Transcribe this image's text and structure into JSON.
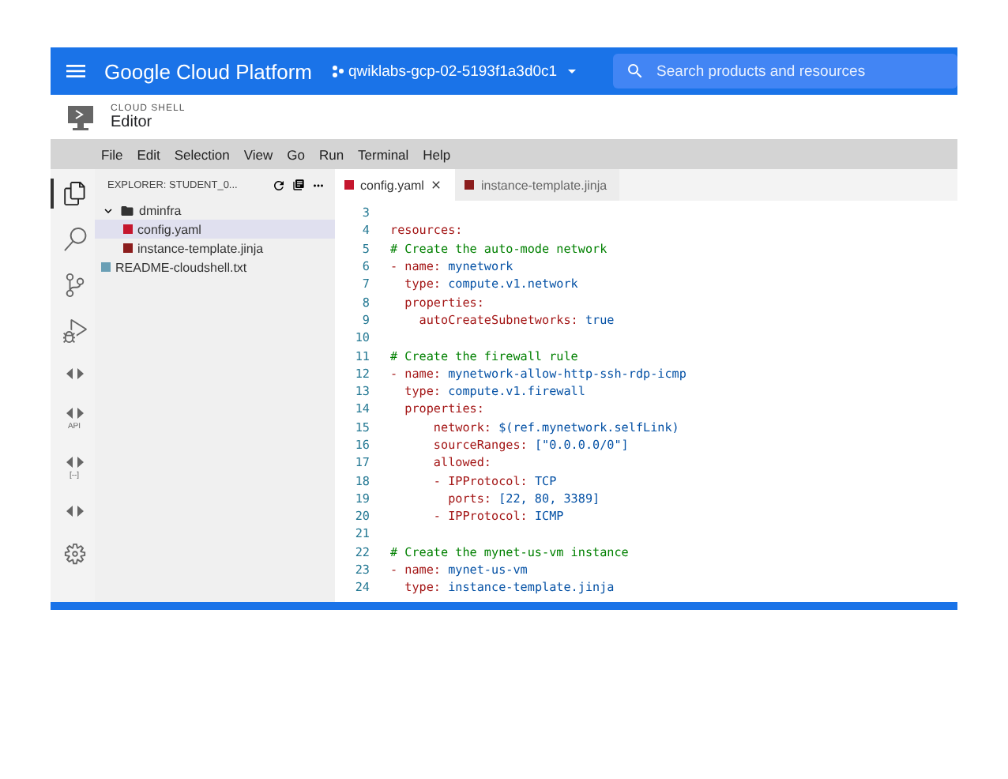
{
  "header": {
    "title": "Google Cloud Platform",
    "project": "qwiklabs-gcp-02-5193f1a3d0c1",
    "search": {
      "placeholder": "Search products and resources"
    }
  },
  "shell_header": {
    "overline": "CLOUD SHELL",
    "title": "Editor"
  },
  "menu": [
    "File",
    "Edit",
    "Selection",
    "View",
    "Go",
    "Run",
    "Terminal",
    "Help"
  ],
  "activity_bar": [
    {
      "kind": "files",
      "selected": true
    },
    {
      "kind": "search",
      "selected": false
    },
    {
      "kind": "source",
      "selected": false
    },
    {
      "kind": "debug",
      "selected": false
    },
    {
      "kind": "code-run",
      "selected": false
    },
    {
      "kind": "code-api",
      "label": "API",
      "selected": false
    },
    {
      "kind": "code-k8s",
      "label": "[--]",
      "selected": false
    },
    {
      "kind": "code-gear",
      "selected": false
    },
    {
      "kind": "settings",
      "selected": false
    }
  ],
  "explorer": {
    "title": "EXPLORER: STUDENT_0...",
    "tree": [
      {
        "name": "dminfra",
        "kind": "folder",
        "expanded": true,
        "selected": false,
        "children": [
          {
            "name": "config.yaml",
            "kind": "yaml",
            "selected": true
          },
          {
            "name": "instance-template.jinja",
            "kind": "jinja",
            "selected": false
          }
        ]
      },
      {
        "name": "README-cloudshell.txt",
        "kind": "text",
        "selected": false
      }
    ]
  },
  "tabs": [
    {
      "label": "config.yaml",
      "kind": "yaml",
      "selected": true
    },
    {
      "label": "instance-template.jinja",
      "kind": "jinja",
      "selected": false
    }
  ],
  "code": [
    {
      "number": "3"
    },
    {
      "number": "4",
      "tokens": [
        {
          "kind": "key",
          "text": "resources:"
        }
      ]
    },
    {
      "number": "5",
      "tokens": [
        {
          "kind": "comment",
          "text": "# Create the auto-mode network"
        }
      ]
    },
    {
      "number": "6",
      "tokens": [
        {
          "kind": "key",
          "text": "- name: "
        },
        {
          "kind": "value",
          "text": "mynetwork"
        }
      ]
    },
    {
      "number": "7",
      "tokens": [
        {
          "kind": "key",
          "text": "  type: "
        },
        {
          "kind": "value",
          "text": "compute.v1.network"
        }
      ]
    },
    {
      "number": "8",
      "tokens": [
        {
          "kind": "key",
          "text": "  properties:"
        }
      ]
    },
    {
      "number": "9",
      "tokens": [
        {
          "kind": "key",
          "text": "    autoCreateSubnetworks: "
        },
        {
          "kind": "value",
          "text": "true"
        }
      ]
    },
    {
      "number": "10"
    },
    {
      "number": "11",
      "tokens": [
        {
          "kind": "comment",
          "text": "# Create the firewall rule"
        }
      ]
    },
    {
      "number": "12",
      "tokens": [
        {
          "kind": "key",
          "text": "- name: "
        },
        {
          "kind": "value",
          "text": "mynetwork-allow-http-ssh-rdp-icmp"
        }
      ]
    },
    {
      "number": "13",
      "tokens": [
        {
          "kind": "key",
          "text": "  type: "
        },
        {
          "kind": "value",
          "text": "compute.v1.firewall"
        }
      ]
    },
    {
      "number": "14",
      "tokens": [
        {
          "kind": "key",
          "text": "  properties:"
        }
      ]
    },
    {
      "number": "15",
      "tokens": [
        {
          "kind": "key",
          "text": "      network: "
        },
        {
          "kind": "value",
          "text": "$(ref.mynetwork.selfLink)"
        }
      ]
    },
    {
      "number": "16",
      "tokens": [
        {
          "kind": "key",
          "text": "      sourceRanges: "
        },
        {
          "kind": "value",
          "text": "[\"0.0.0.0/0\"]"
        }
      ]
    },
    {
      "number": "17",
      "tokens": [
        {
          "kind": "key",
          "text": "      allowed:"
        }
      ]
    },
    {
      "number": "18",
      "tokens": [
        {
          "kind": "key",
          "text": "      - IPProtocol: "
        },
        {
          "kind": "value",
          "text": "TCP"
        }
      ]
    },
    {
      "number": "19",
      "tokens": [
        {
          "kind": "key",
          "text": "        ports: "
        },
        {
          "kind": "value",
          "text": "[22, 80, 3389]"
        }
      ]
    },
    {
      "number": "20",
      "tokens": [
        {
          "kind": "key",
          "text": "      - IPProtocol: "
        },
        {
          "kind": "value",
          "text": "ICMP"
        }
      ]
    },
    {
      "number": "21"
    },
    {
      "number": "22",
      "tokens": [
        {
          "kind": "comment",
          "text": "# Create the mynet-us-vm instance"
        }
      ]
    },
    {
      "number": "23",
      "tokens": [
        {
          "kind": "key",
          "text": "- name: "
        },
        {
          "kind": "value",
          "text": "mynet-us-vm"
        }
      ]
    },
    {
      "number": "24",
      "tokens": [
        {
          "kind": "key",
          "text": "  type: "
        },
        {
          "kind": "value",
          "text": "instance-template.jinja"
        }
      ]
    }
  ]
}
